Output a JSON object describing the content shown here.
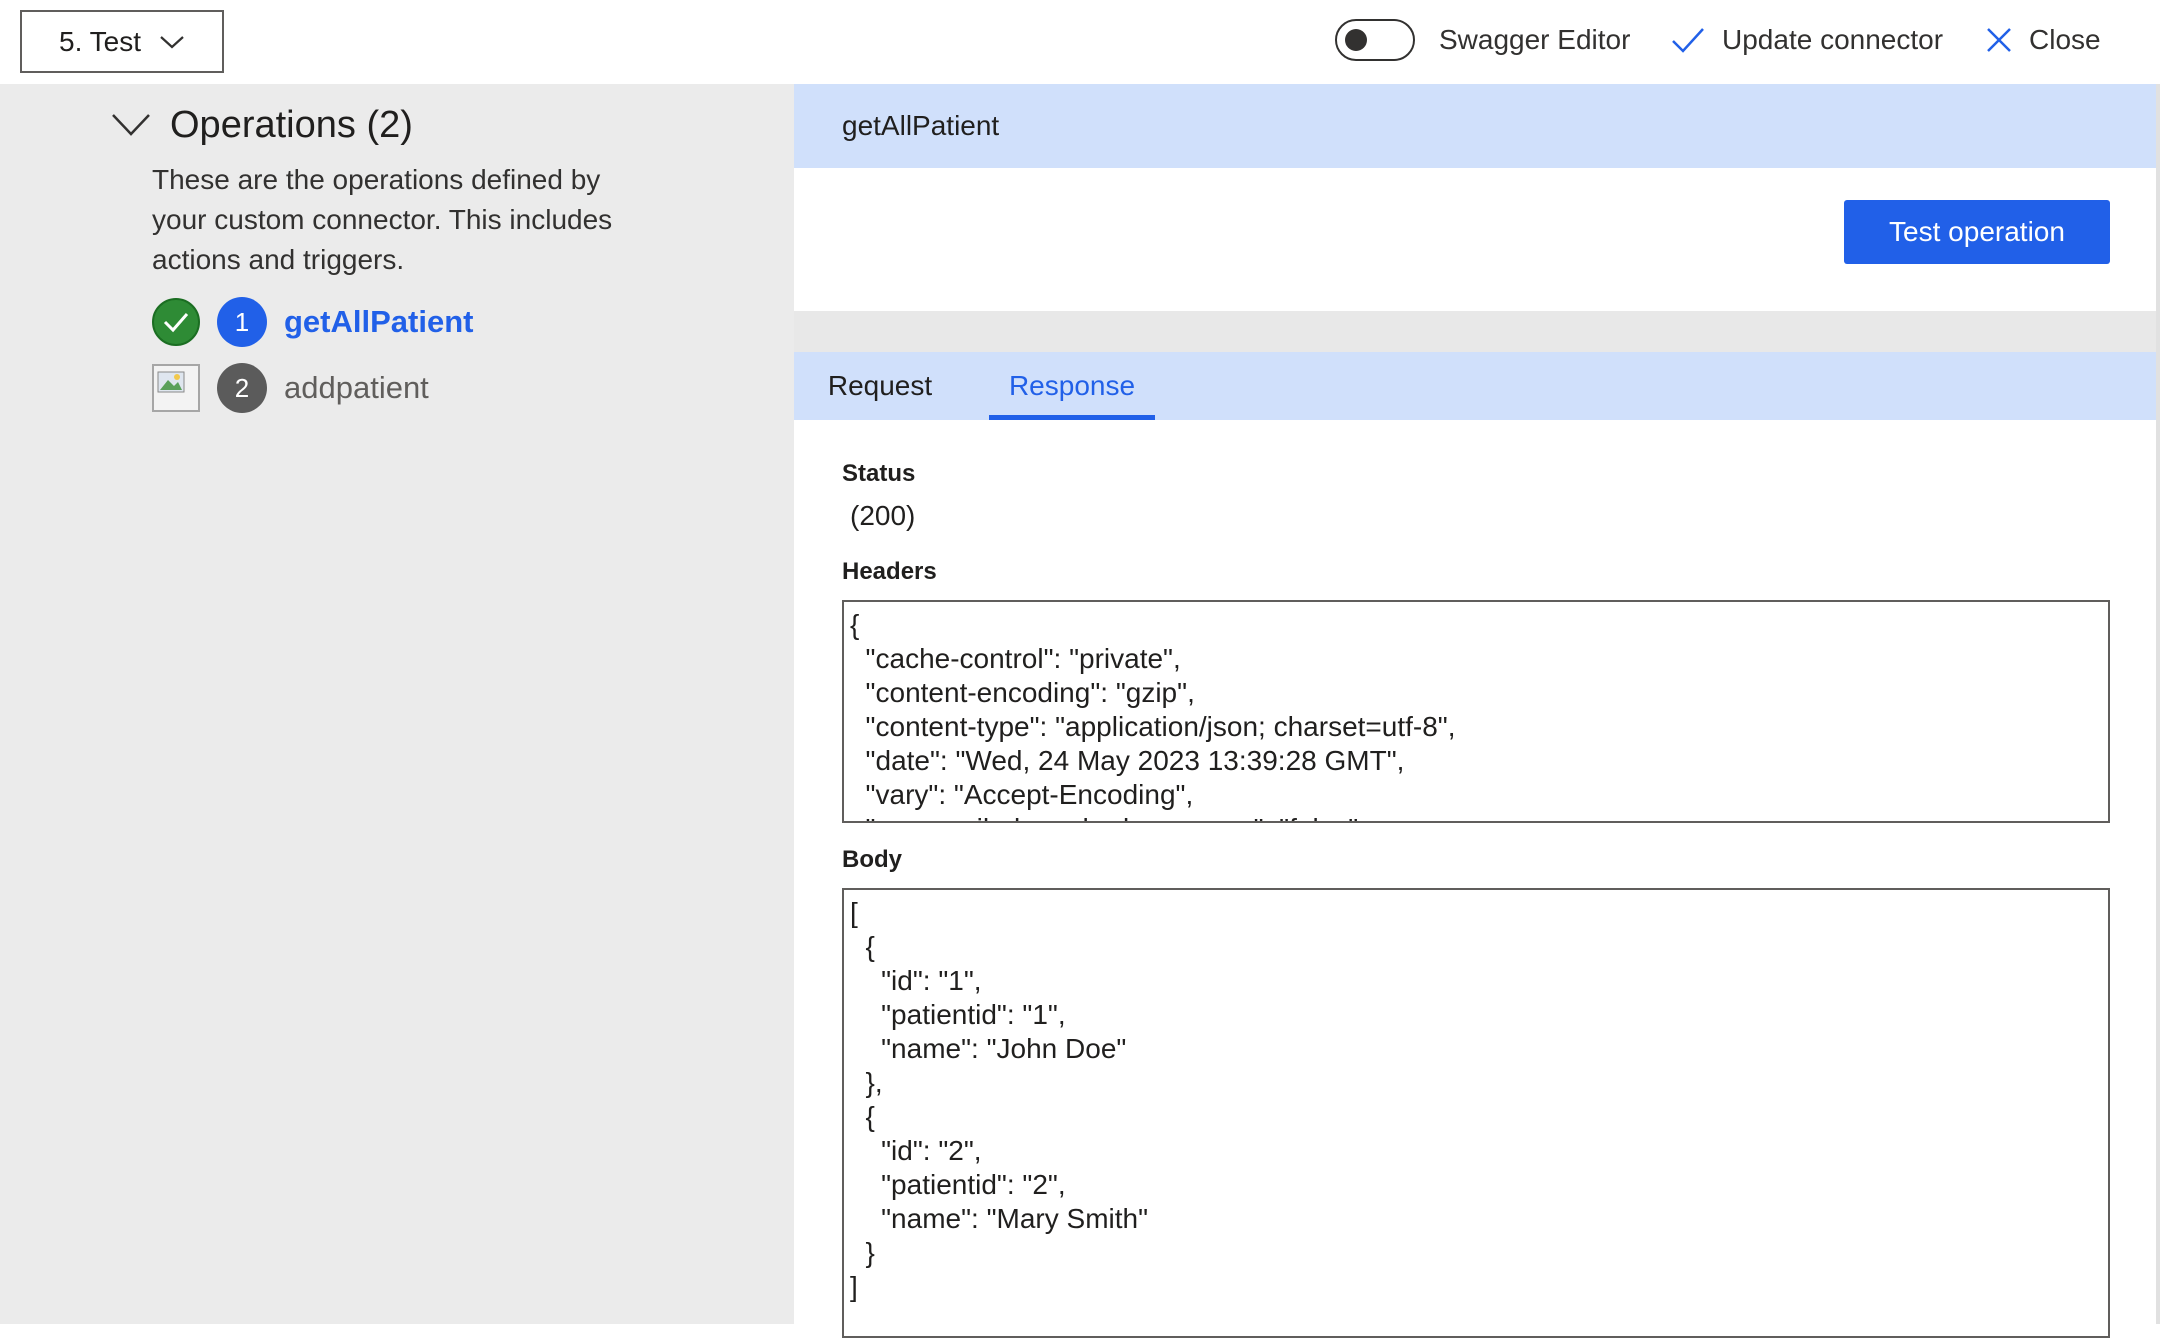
{
  "topbar": {
    "step_label": "5. Test",
    "swagger_toggle_label": "Swagger Editor",
    "swagger_toggle_on": false,
    "update_label": "Update connector",
    "close_label": "Close"
  },
  "operations_panel": {
    "title": "Operations (2)",
    "description": "These are the operations defined by your custom connector. This includes actions and triggers.",
    "items": [
      {
        "number": "1",
        "name": "getAllPatient",
        "status": "success",
        "selected": true
      },
      {
        "number": "2",
        "name": "addpatient",
        "status": "not-tested",
        "selected": false
      }
    ]
  },
  "operation_detail": {
    "title": "getAllPatient",
    "test_button_label": "Test operation",
    "tabs": [
      {
        "label": "Request",
        "active": false
      },
      {
        "label": "Response",
        "active": true
      }
    ]
  },
  "response": {
    "status_label": "Status",
    "status_value": "(200)",
    "headers_label": "Headers",
    "headers_text": "{\n  \"cache-control\": \"private\",\n  \"content-encoding\": \"gzip\",\n  \"content-type\": \"application/json; charset=utf-8\",\n  \"date\": \"Wed, 24 May 2023 13:39:28 GMT\",\n  \"vary\": \"Accept-Encoding\",\n  \"x-ms-apihub-cached-response\": \"false\"",
    "body_label": "Body",
    "body_text": "[\n  {\n    \"id\": \"1\",\n    \"patientid\": \"1\",\n    \"name\": \"John Doe\"\n  },\n  {\n    \"id\": \"2\",\n    \"patientid\": \"2\",\n    \"name\": \"Mary Smith\"\n  }\n]"
  },
  "colors": {
    "accent": "#2160e8",
    "header_band": "#d0e0fb",
    "left_pane": "#ebebeb",
    "success": "#2e8b35"
  },
  "icons": {
    "dropdown": "chevron-down-icon",
    "update": "checkmark-icon",
    "close": "close-icon",
    "collapse": "chevron-down-icon",
    "status_ok": "check-circle-icon",
    "status_unknown": "broken-image-icon"
  }
}
